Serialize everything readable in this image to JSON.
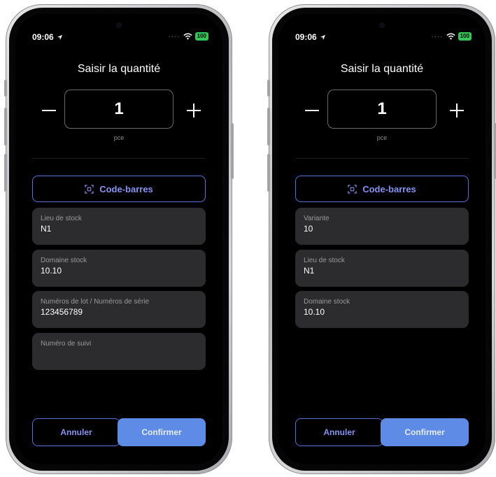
{
  "screens": [
    {
      "status": {
        "time": "09:06",
        "battery": "100"
      },
      "title": "Saisir la quantité",
      "quantity": {
        "value": "1",
        "unit": "pce",
        "minus": "−",
        "plus": "+"
      },
      "barcode_label": "Code-barres",
      "fields": [
        {
          "label": "Lieu de stock",
          "value": "N1"
        },
        {
          "label": "Domaine stock",
          "value": "10.10"
        },
        {
          "label": "Numéros de lot / Numéros de série",
          "value": "123456789"
        },
        {
          "label": "Numéro de suivi",
          "value": ""
        }
      ],
      "cancel_label": "Annuler",
      "confirm_label": "Confirmer"
    },
    {
      "status": {
        "time": "09:06",
        "battery": "100"
      },
      "title": "Saisir la quantité",
      "quantity": {
        "value": "1",
        "unit": "pce",
        "minus": "−",
        "plus": "+"
      },
      "barcode_label": "Code-barres",
      "fields": [
        {
          "label": "Variante",
          "value": "10"
        },
        {
          "label": "Lieu de stock",
          "value": "N1"
        },
        {
          "label": "Domaine stock",
          "value": "10.10"
        }
      ],
      "cancel_label": "Annuler",
      "confirm_label": "Confirmer"
    }
  ],
  "colors": {
    "accent": "#5e6ed9",
    "accent_text": "#8693f2",
    "confirm_bg": "#5e8be6",
    "field_bg": "#2c2c2e",
    "battery_green": "#33c759"
  },
  "icons": {
    "location": "location-arrow-icon",
    "wifi": "wifi-icon",
    "barcode": "barcode-scan-icon"
  }
}
